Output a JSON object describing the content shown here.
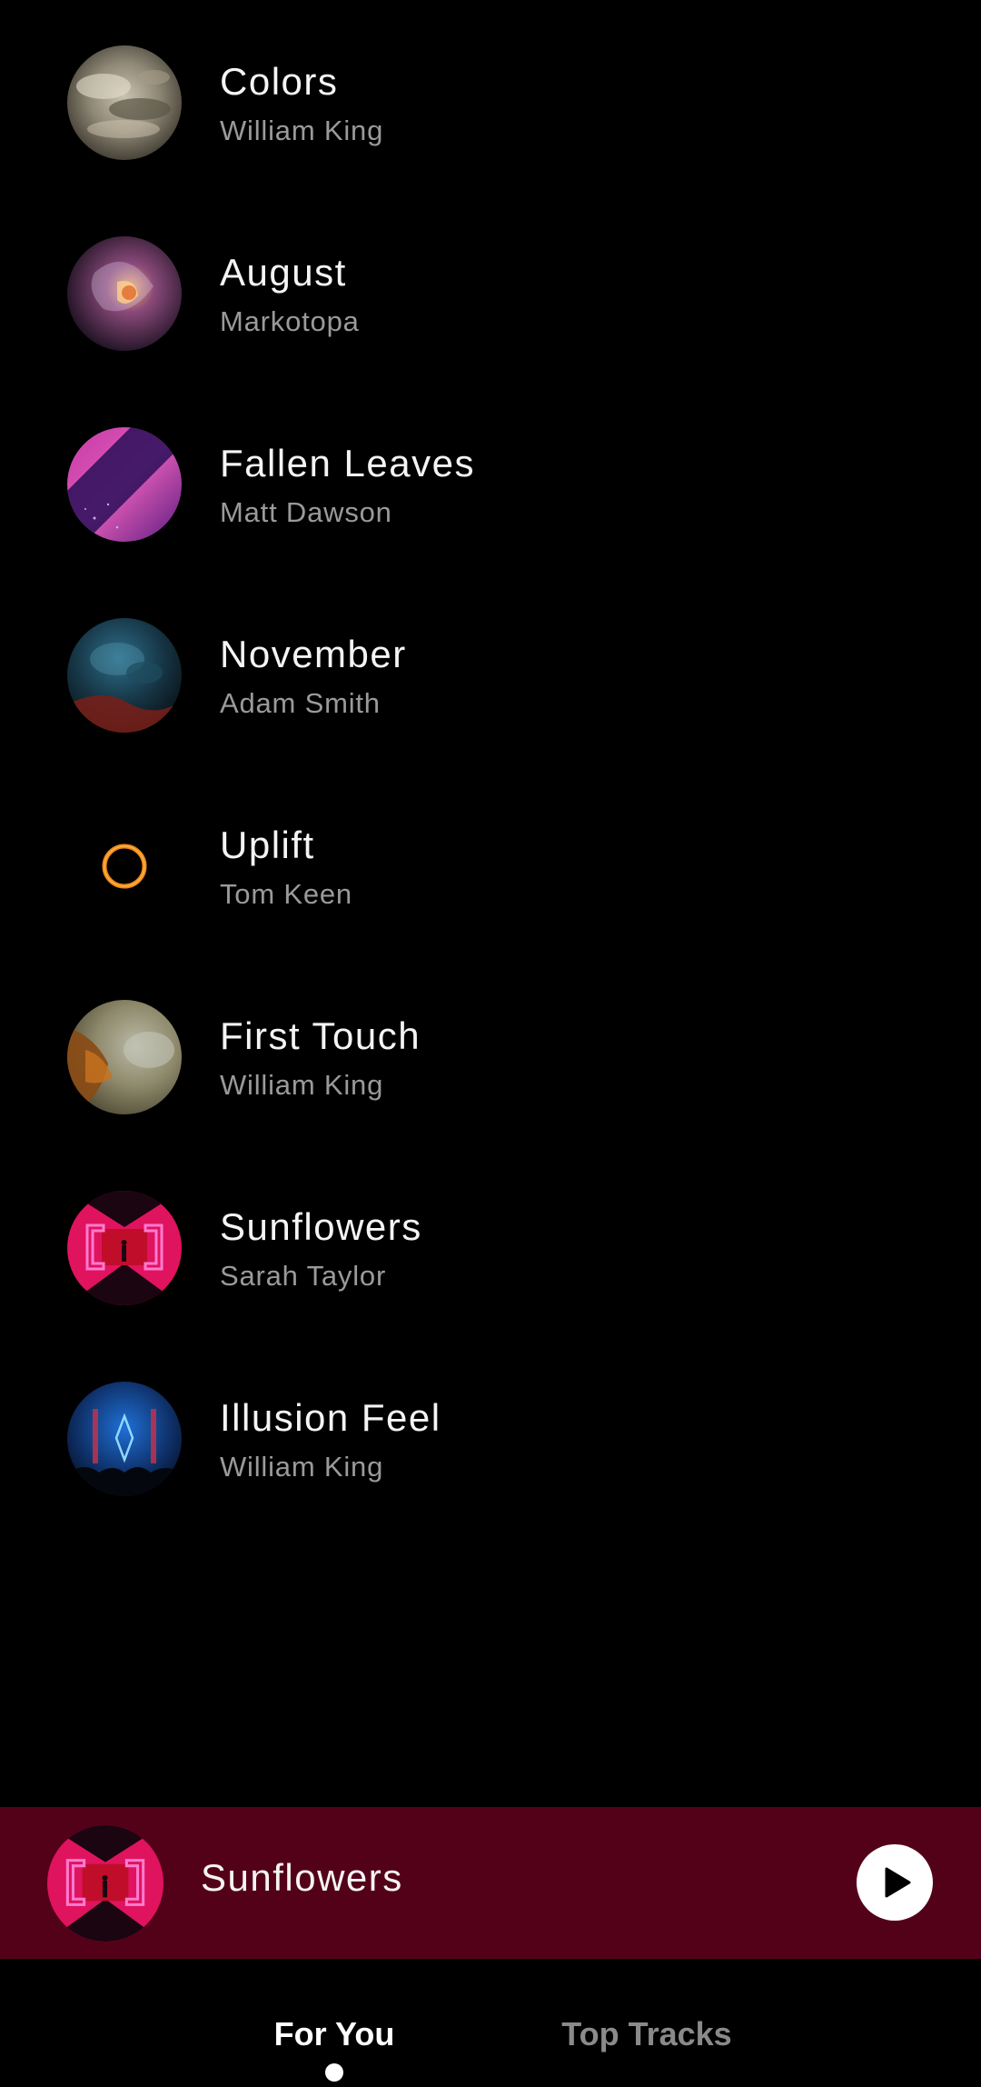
{
  "tracks": [
    {
      "title": "Colors",
      "artist": "William King",
      "art": "colors-cover-art"
    },
    {
      "title": "August",
      "artist": "Markotopa",
      "art": "august-cover-art"
    },
    {
      "title": "Fallen Leaves",
      "artist": "Matt Dawson",
      "art": "fallen-leaves-cover-art"
    },
    {
      "title": "November",
      "artist": "Adam Smith",
      "art": "november-cover-art"
    },
    {
      "title": "Uplift",
      "artist": "Tom Keen",
      "art": "uplift-cover-art"
    },
    {
      "title": "First Touch",
      "artist": "William King",
      "art": "first-touch-cover-art"
    },
    {
      "title": "Sunflowers",
      "artist": "Sarah Taylor",
      "art": "sunflowers-cover-art"
    },
    {
      "title": "Illusion Feel",
      "artist": "William King",
      "art": "illusion-feel-cover-art"
    }
  ],
  "now_playing": {
    "title": "Sunflowers",
    "art": "sunflowers-cover-art",
    "play_icon": "play-icon"
  },
  "nav": {
    "tabs": [
      {
        "label": "For You",
        "active": true
      },
      {
        "label": "Top Tracks",
        "active": false
      }
    ],
    "indicator_icon": "active-tab-dot"
  },
  "colors": {
    "background": "#000000",
    "mini_player": "#530119",
    "title_text": "#f4f4f4",
    "artist_text": "#9a9a9a",
    "inactive_tab": "#8a8a8a"
  }
}
